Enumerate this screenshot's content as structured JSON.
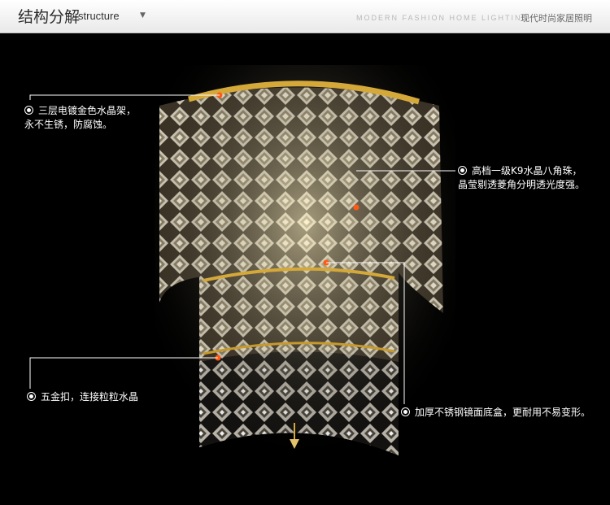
{
  "header": {
    "title_cn": "结构分解",
    "title_en": "structure",
    "title_arrow": "▼",
    "brand_en": "MODERN FASHION HOME LIGHTING",
    "brand_cn": "现代时尚家居照明"
  },
  "callouts": {
    "frame_line1": "三层电镀金色水晶架，",
    "frame_line2": "永不生锈，防腐蚀。",
    "crystal_line1": "高档一级K9水晶八角珠，",
    "crystal_line2": "晶莹剔透菱角分明透光度强。",
    "buckle": "五金扣，连接粒粒水晶",
    "base": "加厚不锈钢镜面底盒，更耐用不易变形。"
  },
  "colors": {
    "background": "#000000",
    "gold": "#d4a93a",
    "crystal": "#cfc9b8"
  }
}
